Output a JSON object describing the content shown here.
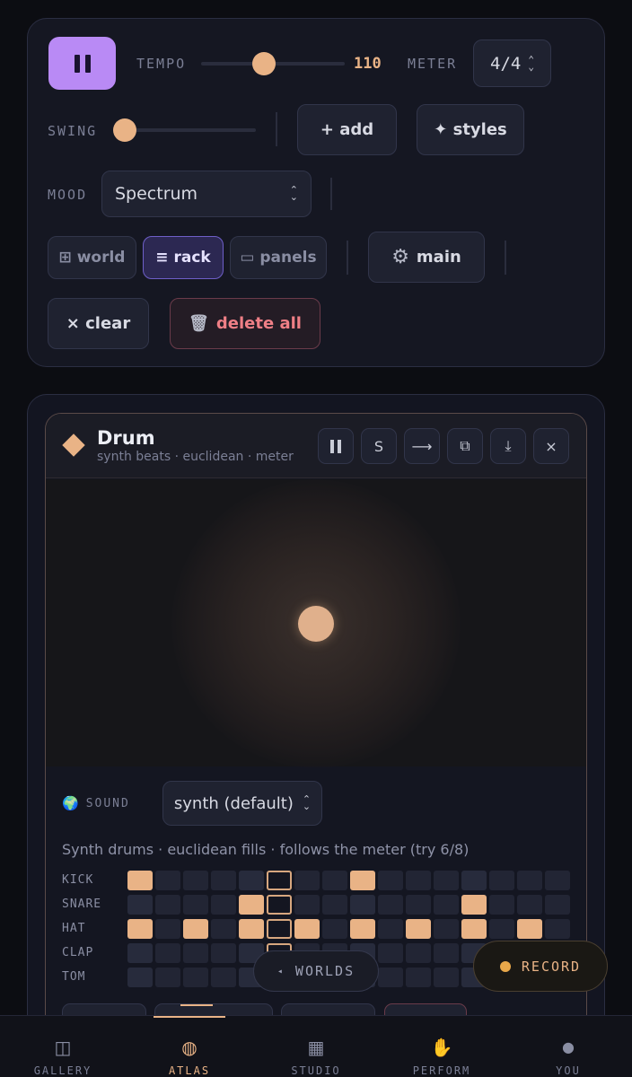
{
  "transport": {
    "tempo_label": "TEMPO",
    "tempo_value": "110",
    "tempo_fraction": 0.44,
    "meter_label": "METER",
    "meter_value": "4/4",
    "swing_label": "SWING",
    "swing_fraction": 0.05
  },
  "toolbar": {
    "add_label": "+ add",
    "styles_label": "✦ styles",
    "mood_label": "MOOD",
    "mood_value": "Spectrum",
    "world_label": "⊞ world",
    "rack_label": "≡ rack",
    "panels_label": "▭ panels",
    "main_label": "main",
    "clear_label": "× clear",
    "delete_all_label": "delete all"
  },
  "module": {
    "title": "Drum",
    "subtitle": "synth beats · euclidean · meter",
    "header_buttons": [
      "pause",
      "S",
      "⟶",
      "⧉",
      "⤓",
      "×"
    ],
    "sound_label": "SOUND",
    "sound_value": "synth (default)",
    "description": "Synth drums · euclidean fills · follows the meter (try 6/8)",
    "playhead_step": 5,
    "tracks": [
      {
        "name": "KICK",
        "steps": [
          1,
          0,
          0,
          0,
          0,
          0,
          0,
          0,
          1,
          0,
          0,
          0,
          0,
          0,
          0,
          0
        ]
      },
      {
        "name": "SNARE",
        "steps": [
          0,
          0,
          0,
          0,
          1,
          0,
          0,
          0,
          0,
          0,
          0,
          0,
          1,
          0,
          0,
          0
        ]
      },
      {
        "name": "HAT",
        "steps": [
          1,
          0,
          1,
          0,
          1,
          0,
          1,
          0,
          1,
          0,
          1,
          0,
          1,
          0,
          1,
          0
        ]
      },
      {
        "name": "CLAP",
        "steps": [
          0,
          0,
          0,
          0,
          0,
          0,
          0,
          0,
          0,
          0,
          0,
          0,
          0,
          0,
          0,
          0
        ]
      },
      {
        "name": "TOM",
        "steps": [
          0,
          0,
          0,
          0,
          0,
          0,
          0,
          0,
          0,
          0,
          0,
          0,
          0,
          0,
          0,
          0
        ]
      }
    ]
  },
  "floating": {
    "worlds_label": "WORLDS",
    "record_label": "RECORD"
  },
  "nav": {
    "items": [
      {
        "label": "GALLERY",
        "icon": "◫"
      },
      {
        "label": "ATLAS",
        "icon": "◍"
      },
      {
        "label": "STUDIO",
        "icon": "▦"
      },
      {
        "label": "PERFORM",
        "icon": "✋"
      },
      {
        "label": "YOU",
        "icon": "●"
      }
    ],
    "active_index": 1
  },
  "colors": {
    "accent": "#e9b386",
    "play_button": "#b98af5",
    "danger": "#ef7f86",
    "active_view": "#6e5fc8"
  }
}
